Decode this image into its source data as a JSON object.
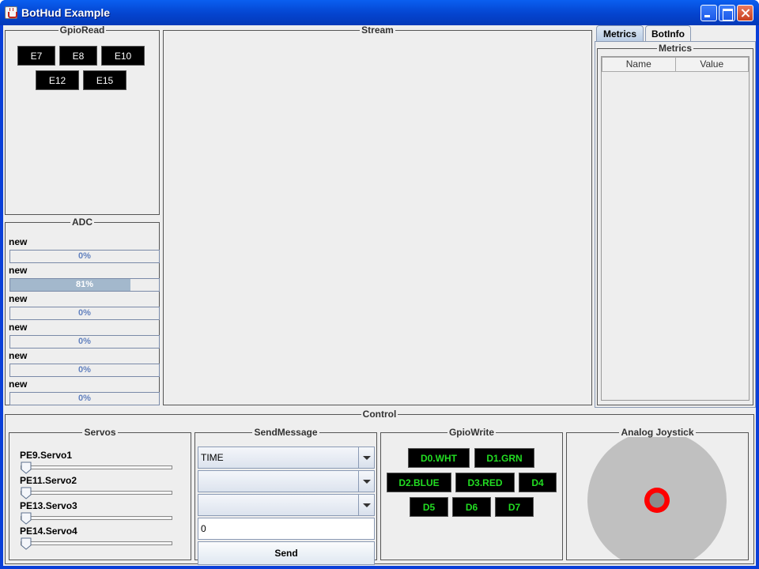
{
  "window": {
    "title": "BotHud Example"
  },
  "gpio_read": {
    "title": "GpioRead",
    "buttons": [
      "E7",
      "E8",
      "E10",
      "E12",
      "E15"
    ]
  },
  "adc": {
    "title": "ADC",
    "channels": [
      {
        "label": "new",
        "value": 0.0,
        "text": "0%"
      },
      {
        "label": "new",
        "value": 0.81,
        "text": "81%"
      },
      {
        "label": "new",
        "value": 0.0,
        "text": "0%"
      },
      {
        "label": "new",
        "value": 0.0,
        "text": "0%"
      },
      {
        "label": "new",
        "value": 0.0,
        "text": "0%"
      },
      {
        "label": "new",
        "value": 0.0,
        "text": "0%"
      }
    ]
  },
  "stream": {
    "title": "Stream"
  },
  "right_panel": {
    "tabs": [
      {
        "label": "Metrics",
        "active": true
      },
      {
        "label": "BotInfo",
        "active": false
      }
    ],
    "metrics": {
      "title": "Metrics",
      "columns": [
        "Name",
        "Value"
      ]
    }
  },
  "control": {
    "title": "Control",
    "servos": {
      "title": "Servos",
      "items": [
        {
          "label": "PE9.Servo1",
          "value": 0
        },
        {
          "label": "PE11.Servo2",
          "value": 0
        },
        {
          "label": "PE13.Servo3",
          "value": 0
        },
        {
          "label": "PE14.Servo4",
          "value": 0
        }
      ]
    },
    "send_message": {
      "title": "SendMessage",
      "combo1": "TIME",
      "combo2": "",
      "combo3": "",
      "text_value": "0",
      "send_label": "Send"
    },
    "gpio_write": {
      "title": "GpioWrite",
      "buttons": [
        "D0.WHT",
        "D1.GRN",
        "D2.BLUE",
        "D3.RED",
        "D4",
        "D5",
        "D6",
        "D7"
      ]
    },
    "joystick": {
      "title": "Analog Joystick",
      "x": 0.0,
      "y": 0.0
    }
  },
  "colors": {
    "button_bg": "#000000",
    "gpio_write_text": "#22dd22",
    "joystick_pad": "#c0c0c0",
    "joystick_ring": "#ff0000",
    "progress_fill": "#a3b8cc"
  }
}
